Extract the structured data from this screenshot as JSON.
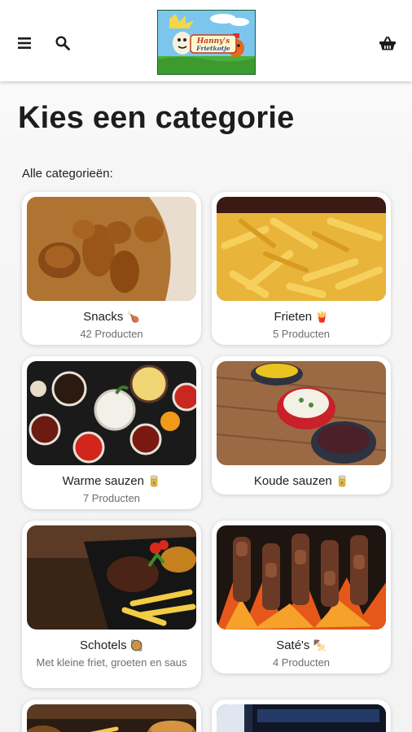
{
  "header": {
    "logo_alt": "Hanny's Frietkotje",
    "logo_line1": "Hanny's",
    "logo_line2": "Frietkotje"
  },
  "page": {
    "title": "Kies een categorie",
    "section_label": "Alle categorieën:"
  },
  "categories": [
    {
      "title": "Snacks",
      "emoji": "🍗",
      "subtitle": "42 Producten"
    },
    {
      "title": "Frieten",
      "emoji": "🍟",
      "subtitle": "5 Producten"
    },
    {
      "title": "Warme sauzen",
      "emoji": "🥫",
      "subtitle": "7 Producten"
    },
    {
      "title": "Koude sauzen",
      "emoji": "🥫",
      "subtitle": ""
    },
    {
      "title": "Schotels",
      "emoji": "🥘",
      "subtitle": "Met kleine friet, groeten en saus"
    },
    {
      "title": "Saté's",
      "emoji": "🍢",
      "subtitle": "4 Producten"
    },
    {
      "title": "",
      "emoji": "",
      "subtitle": ""
    },
    {
      "title": "",
      "emoji": "",
      "subtitle": ""
    }
  ],
  "colors": {
    "accent_text": "#1d1d1d",
    "muted_text": "#6e6e6e",
    "card_bg": "#ffffff"
  }
}
